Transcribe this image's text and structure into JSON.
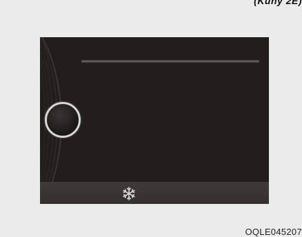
{
  "header_label": "(Kuny 2E)",
  "figure_code": "OQLE045207",
  "display": {
    "background_color": "#231e1e",
    "bar_color": "#3a3535",
    "icons": {
      "dial": "dial-knob-icon",
      "bar": "snowflake-icon"
    }
  }
}
